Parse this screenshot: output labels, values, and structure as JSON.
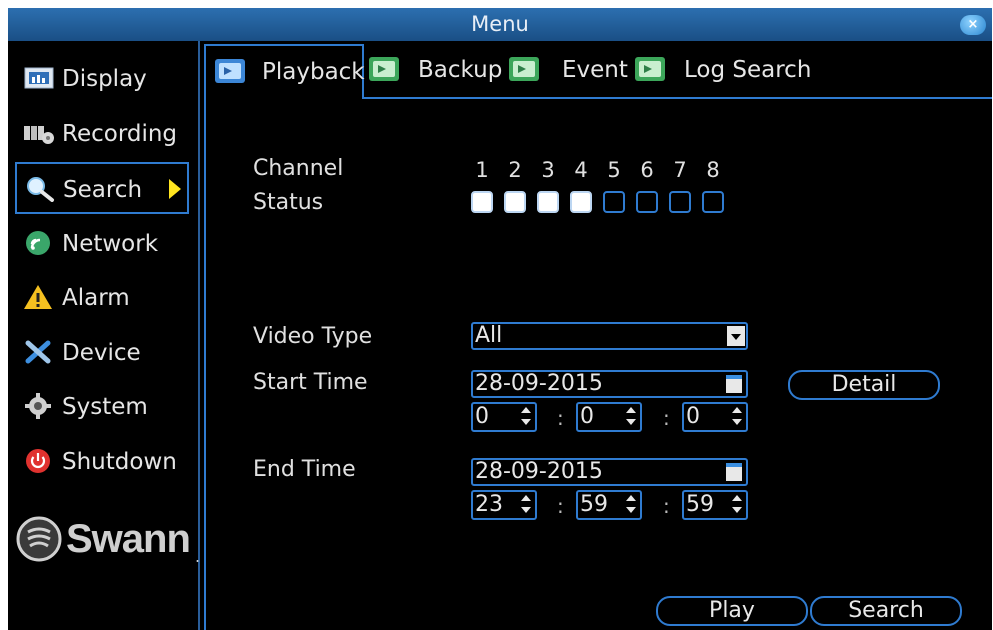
{
  "window": {
    "title": "Menu",
    "close_icon": "close-icon"
  },
  "sidebar": {
    "items": [
      {
        "label": "Display",
        "icon": "display-icon"
      },
      {
        "label": "Recording",
        "icon": "recording-icon"
      },
      {
        "label": "Search",
        "icon": "search-icon",
        "selected": true
      },
      {
        "label": "Network",
        "icon": "network-icon"
      },
      {
        "label": "Alarm",
        "icon": "alarm-icon"
      },
      {
        "label": "Device",
        "icon": "device-icon"
      },
      {
        "label": "System",
        "icon": "system-icon"
      },
      {
        "label": "Shutdown",
        "icon": "shutdown-icon"
      }
    ],
    "logo": {
      "text": "Swann",
      "mark": "."
    }
  },
  "tabs": [
    {
      "label": "Playback",
      "active": true
    },
    {
      "label": "Backup"
    },
    {
      "label": "Event"
    },
    {
      "label": "Log Search"
    }
  ],
  "playback": {
    "channel_label": "Channel",
    "status_label": "Status",
    "channels": [
      "1",
      "2",
      "3",
      "4",
      "5",
      "6",
      "7",
      "8"
    ],
    "channel_selected": [
      true,
      true,
      true,
      true,
      false,
      false,
      false,
      false
    ],
    "video_type_label": "Video Type",
    "video_type_value": "All",
    "start_time_label": "Start Time",
    "start_date": "28-09-2015",
    "start_hour": "0",
    "start_minute": "0",
    "start_second": "0",
    "end_time_label": "End Time",
    "end_date": "28-09-2015",
    "end_hour": "23",
    "end_minute": "59",
    "end_second": "59",
    "time_separator": ":",
    "detail_button": "Detail",
    "play_button": "Play",
    "search_button": "Search"
  },
  "colors": {
    "accent": "#2f7bd0",
    "titlebar": "#1a4f85",
    "background": "#000000",
    "arrow": "#ffe51f"
  }
}
